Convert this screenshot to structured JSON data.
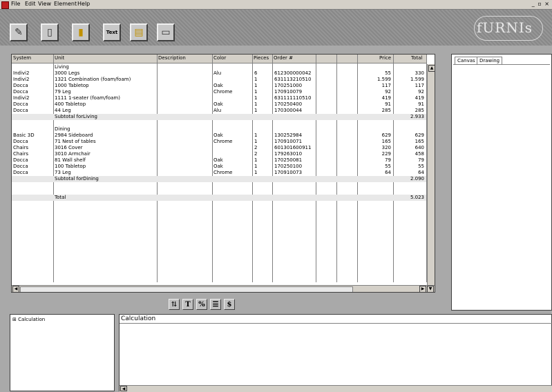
{
  "menu": {
    "items": [
      "File",
      "Edit",
      "View",
      "Element",
      "Help"
    ],
    "window_controls": "_ ▫ ×"
  },
  "toolbar": {
    "buttons": [
      "edit-icon",
      "cabinet-icon",
      "door-cabinet-icon",
      "text-icon",
      "drawer-cabinet-icon",
      "panel-icon"
    ],
    "text_button_label": "Text"
  },
  "logo": {
    "text": "fURNIs"
  },
  "table": {
    "columns": [
      "System",
      "Unit",
      "Description",
      "Color",
      "Pieces",
      "Order #",
      "",
      "",
      "Price",
      "Total"
    ],
    "rows": [
      {
        "system": "",
        "unit": "Living",
        "desc": "",
        "color": "",
        "pieces": "",
        "order": "",
        "price": "",
        "total": "",
        "type": "group"
      },
      {
        "system": "Indivi2",
        "unit": "3000 Legs",
        "desc": "",
        "color": "Alu",
        "pieces": "6",
        "order": "612300000042",
        "price": "55",
        "total": "330",
        "type": "item"
      },
      {
        "system": "Indivi2",
        "unit": "1321 Combination (foam/foam)",
        "desc": "",
        "color": "",
        "pieces": "1",
        "order": "631113210510",
        "price": "1.599",
        "total": "1.599",
        "type": "item"
      },
      {
        "system": "Docca",
        "unit": "1000 Tabletop",
        "desc": "",
        "color": "Oak",
        "pieces": "1",
        "order": "170251000",
        "price": "117",
        "total": "117",
        "type": "item"
      },
      {
        "system": "Docca",
        "unit": "79 Leg",
        "desc": "",
        "color": "Chrome",
        "pieces": "1",
        "order": "170910079",
        "price": "92",
        "total": "92",
        "type": "item"
      },
      {
        "system": "Indivi2",
        "unit": "1111 1-seater (foam/foam)",
        "desc": "",
        "color": "",
        "pieces": "1",
        "order": "631111110510",
        "price": "419",
        "total": "419",
        "type": "item"
      },
      {
        "system": "Docca",
        "unit": "400 Tabletop",
        "desc": "",
        "color": "Oak",
        "pieces": "1",
        "order": "170250400",
        "price": "91",
        "total": "91",
        "type": "item"
      },
      {
        "system": "Docca",
        "unit": "44 Leg",
        "desc": "",
        "color": "Alu",
        "pieces": "1",
        "order": "170300044",
        "price": "285",
        "total": "285",
        "type": "item"
      },
      {
        "system": "",
        "unit": "Subtotal forLiving",
        "desc": "",
        "color": "",
        "pieces": "",
        "order": "",
        "price": "",
        "total": "2.933",
        "type": "subtotal"
      },
      {
        "system": "",
        "unit": "",
        "desc": "",
        "color": "",
        "pieces": "",
        "order": "",
        "price": "",
        "total": "",
        "type": "blank"
      },
      {
        "system": "",
        "unit": "Dining",
        "desc": "",
        "color": "",
        "pieces": "",
        "order": "",
        "price": "",
        "total": "",
        "type": "group"
      },
      {
        "system": "Basic 3D",
        "unit": "2984 Sideboard",
        "desc": "",
        "color": "Oak",
        "pieces": "1",
        "order": "130252984",
        "price": "629",
        "total": "629",
        "type": "item"
      },
      {
        "system": "Docca",
        "unit": "71 Nest of tables",
        "desc": "",
        "color": "Chrome",
        "pieces": "1",
        "order": "170910071",
        "price": "165",
        "total": "165",
        "type": "item"
      },
      {
        "system": "Chairs",
        "unit": "3016 Cover",
        "desc": "",
        "color": "",
        "pieces": "2",
        "order": "601301600911",
        "price": "320",
        "total": "640",
        "type": "item"
      },
      {
        "system": "Chairs",
        "unit": "3010 Armchair",
        "desc": "",
        "color": "",
        "pieces": "2",
        "order": "179263010",
        "price": "229",
        "total": "458",
        "type": "item"
      },
      {
        "system": "Docca",
        "unit": "81 Wall shelf",
        "desc": "",
        "color": "Oak",
        "pieces": "1",
        "order": "170250081",
        "price": "79",
        "total": "79",
        "type": "item"
      },
      {
        "system": "Docca",
        "unit": "100 Tabletop",
        "desc": "",
        "color": "Oak",
        "pieces": "1",
        "order": "170250100",
        "price": "55",
        "total": "55",
        "type": "item"
      },
      {
        "system": "Docca",
        "unit": "73 Leg",
        "desc": "",
        "color": "Chrome",
        "pieces": "1",
        "order": "170910073",
        "price": "64",
        "total": "64",
        "type": "item"
      },
      {
        "system": "",
        "unit": "Subtotal forDining",
        "desc": "",
        "color": "",
        "pieces": "",
        "order": "",
        "price": "",
        "total": "2.090",
        "type": "subtotal"
      },
      {
        "system": "",
        "unit": "",
        "desc": "",
        "color": "",
        "pieces": "",
        "order": "",
        "price": "",
        "total": "",
        "type": "blank"
      },
      {
        "system": "",
        "unit": "",
        "desc": "",
        "color": "",
        "pieces": "",
        "order": "",
        "price": "",
        "total": "",
        "type": "blank"
      },
      {
        "system": "",
        "unit": "Total",
        "desc": "",
        "color": "",
        "pieces": "",
        "order": "",
        "price": "",
        "total": "5.023",
        "type": "subtotal"
      }
    ]
  },
  "bottom_toolbar": {
    "buttons": [
      "sort-icon",
      "T",
      "%",
      "list-icon",
      "$"
    ]
  },
  "right_panel": {
    "tabs": [
      "Canvas",
      "Drawing"
    ]
  },
  "calc_list": {
    "item": "Calculation"
  },
  "calc_panel": {
    "title": "Calculation"
  }
}
